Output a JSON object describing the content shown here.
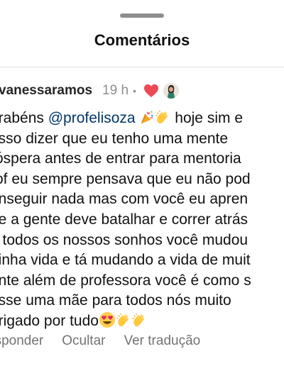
{
  "sheet": {
    "title": "Comentários"
  },
  "comment": {
    "username": "vanessaramos",
    "time": "19 h",
    "separator": "•",
    "lines": [
      {
        "pre": "arabéns ",
        "mention": "@profelisoza",
        "post": " hoje sim e",
        "emoji_after_mention": [
          "party-popper",
          "clapping-hands"
        ]
      },
      {
        "text": "osso dizer que eu tenho uma mente"
      },
      {
        "text": "róspera antes de entrar para mentoria"
      },
      {
        "text": "rof eu sempre pensava que eu não pod"
      },
      {
        "text": "onseguir nada mas com você eu apren"
      },
      {
        "text": "ue a gente deve batalhar e correr atrás"
      },
      {
        "text": "e todos os nossos sonhos você mudou"
      },
      {
        "text": "ninha vida e tá mudando a vida de muit"
      },
      {
        "text": "ente além de professora você é como s"
      },
      {
        "text": "osse uma mãe para todos nós muito"
      },
      {
        "text": "brigado por tudo",
        "emoji_after": [
          "heart-eyes",
          "clapping-hands",
          "clapping-hands"
        ]
      }
    ],
    "actions": {
      "reply": "esponder",
      "hide": "Ocultar",
      "translate": "Ver tradução"
    }
  },
  "colors": {
    "mention": "#00376b",
    "heart": "#ed4956",
    "muted": "#737373"
  }
}
